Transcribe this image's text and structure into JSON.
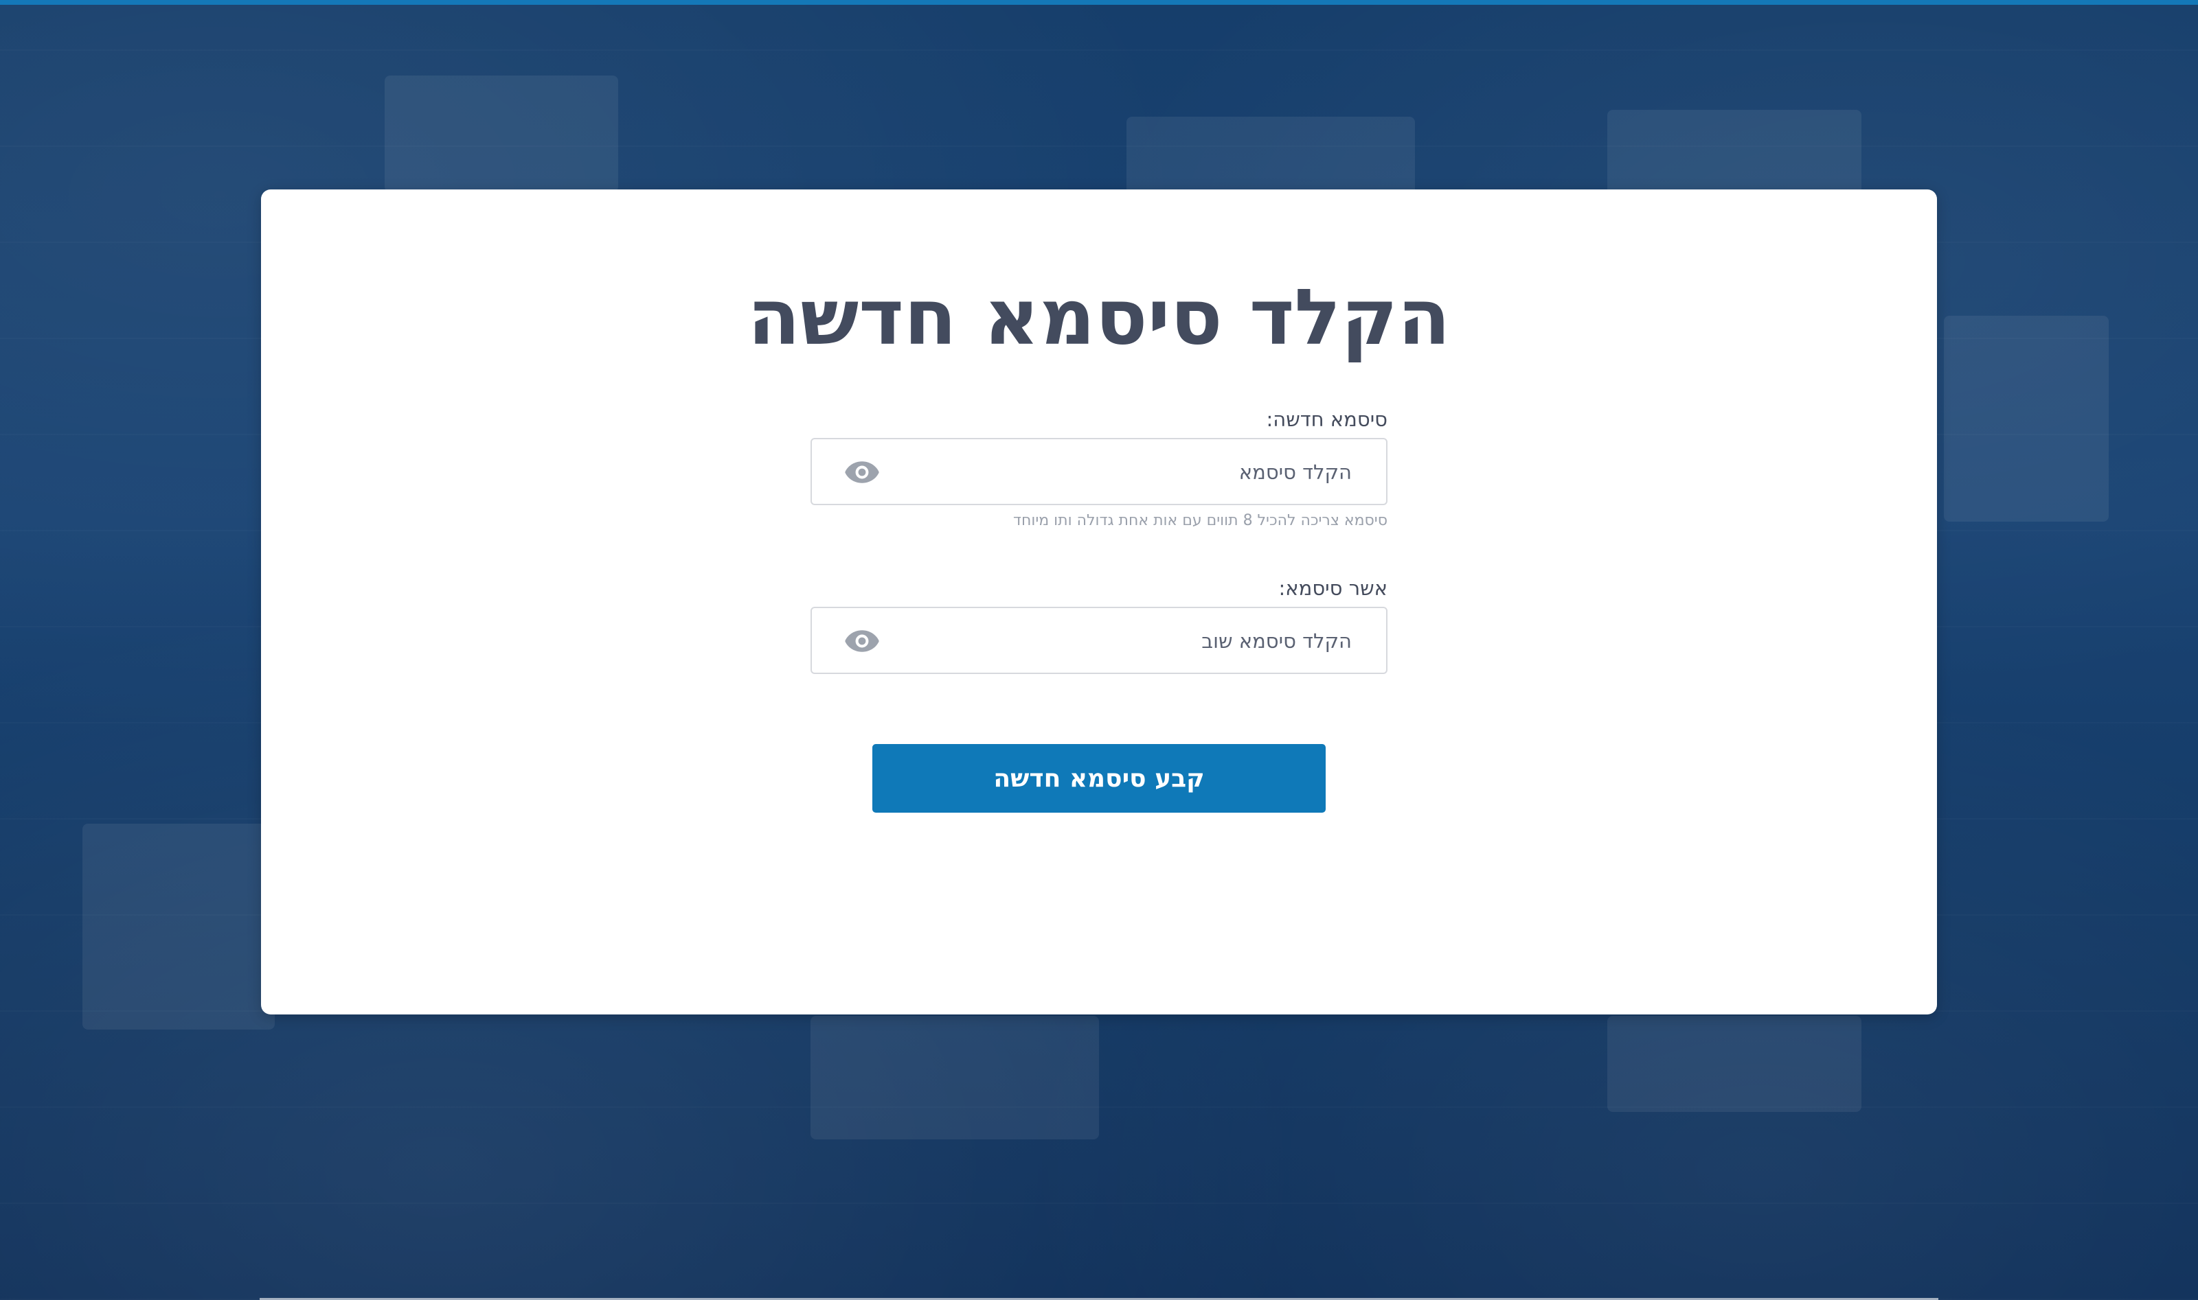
{
  "page": {
    "title": "הקלד סיסמא חדשה"
  },
  "form": {
    "new_password": {
      "label": "סיסמא חדשה:",
      "placeholder": "הקלד סיסמא",
      "value": "",
      "hint": "סיסמא צריכה להכיל 8 תווים עם אות אחת גדולה ותו מיוחד",
      "icon": "eye-icon"
    },
    "confirm_password": {
      "label": "אשר סיסמא:",
      "placeholder": "הקלד סיסמא שוב",
      "value": "",
      "icon": "eye-icon"
    },
    "submit_label": "קבע סיסמא חדשה"
  },
  "colors": {
    "accent": "#0f79b8",
    "top_bar": "#1478b8",
    "title": "#434b5e",
    "background_overlay": "#123a68"
  }
}
